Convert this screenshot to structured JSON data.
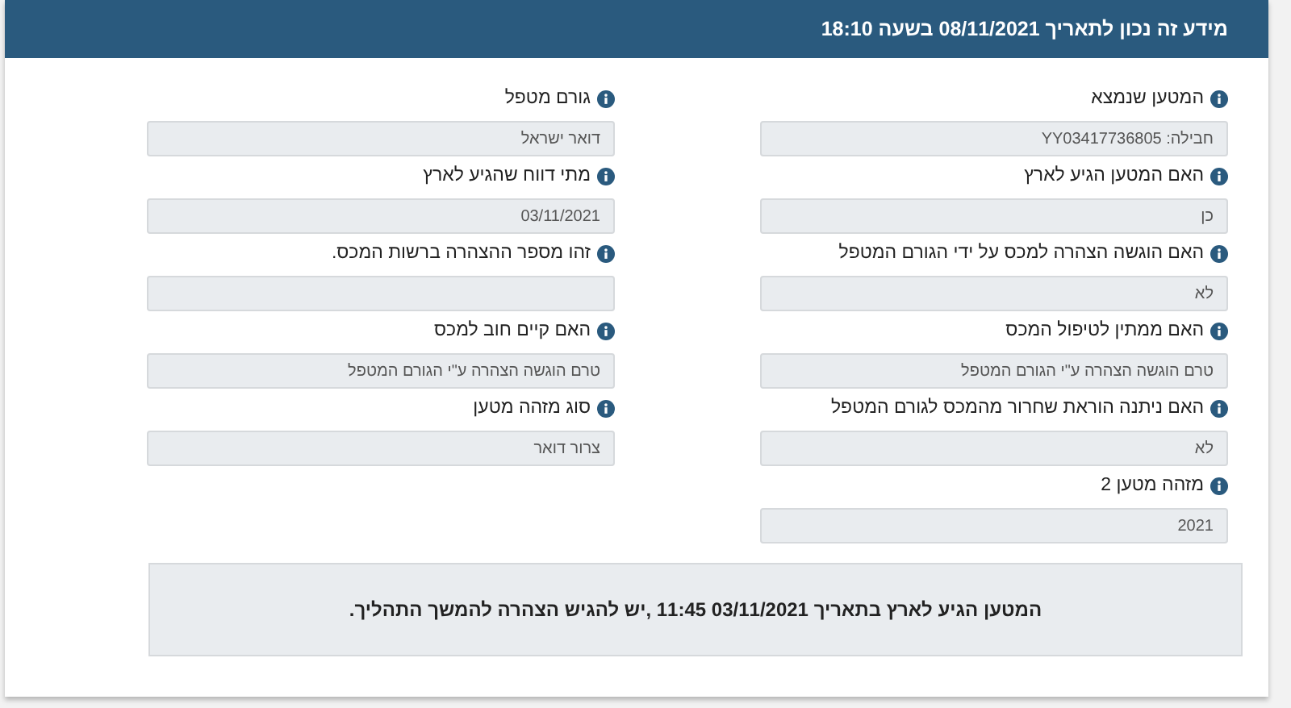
{
  "header": {
    "title": "מידע זה נכון לתאריך 08/11/2021 בשעה 18:10"
  },
  "columns": [
    {
      "fields": [
        {
          "label": "המטען שנמצא",
          "value": "חבילה: YY03417736805"
        },
        {
          "label": "האם המטען הגיע לארץ",
          "value": "כן"
        },
        {
          "label": "האם הוגשה הצהרה למכס על ידי הגורם המטפל",
          "value": "לא"
        },
        {
          "label": "האם ממתין לטיפול המכס",
          "value": "טרם הוגשה הצהרה ע\"י הגורם המטפל"
        },
        {
          "label": "האם ניתנה הוראת שחרור מהמכס לגורם המטפל",
          "value": "לא"
        },
        {
          "label": "מזהה מטען 2",
          "value": "2021"
        }
      ]
    },
    {
      "fields": [
        {
          "label": "גורם מטפל",
          "value": "דואר ישראל"
        },
        {
          "label": "מתי דווח שהגיע לארץ",
          "value": "03/11/2021"
        },
        {
          "label": "זהו מספר ההצהרה ברשות המכס."
        },
        {
          "label": "האם קיים חוב למכס",
          "value": "טרם הוגשה הצהרה ע\"י הגורם המטפל"
        },
        {
          "label": "סוג מזהה מטען",
          "value": "צרור דואר"
        }
      ]
    }
  ],
  "notice": "המטען הגיע לארץ בתאריך 03/11/2021 11:45 ,יש להגיש הצהרה להמשך התהליך."
}
